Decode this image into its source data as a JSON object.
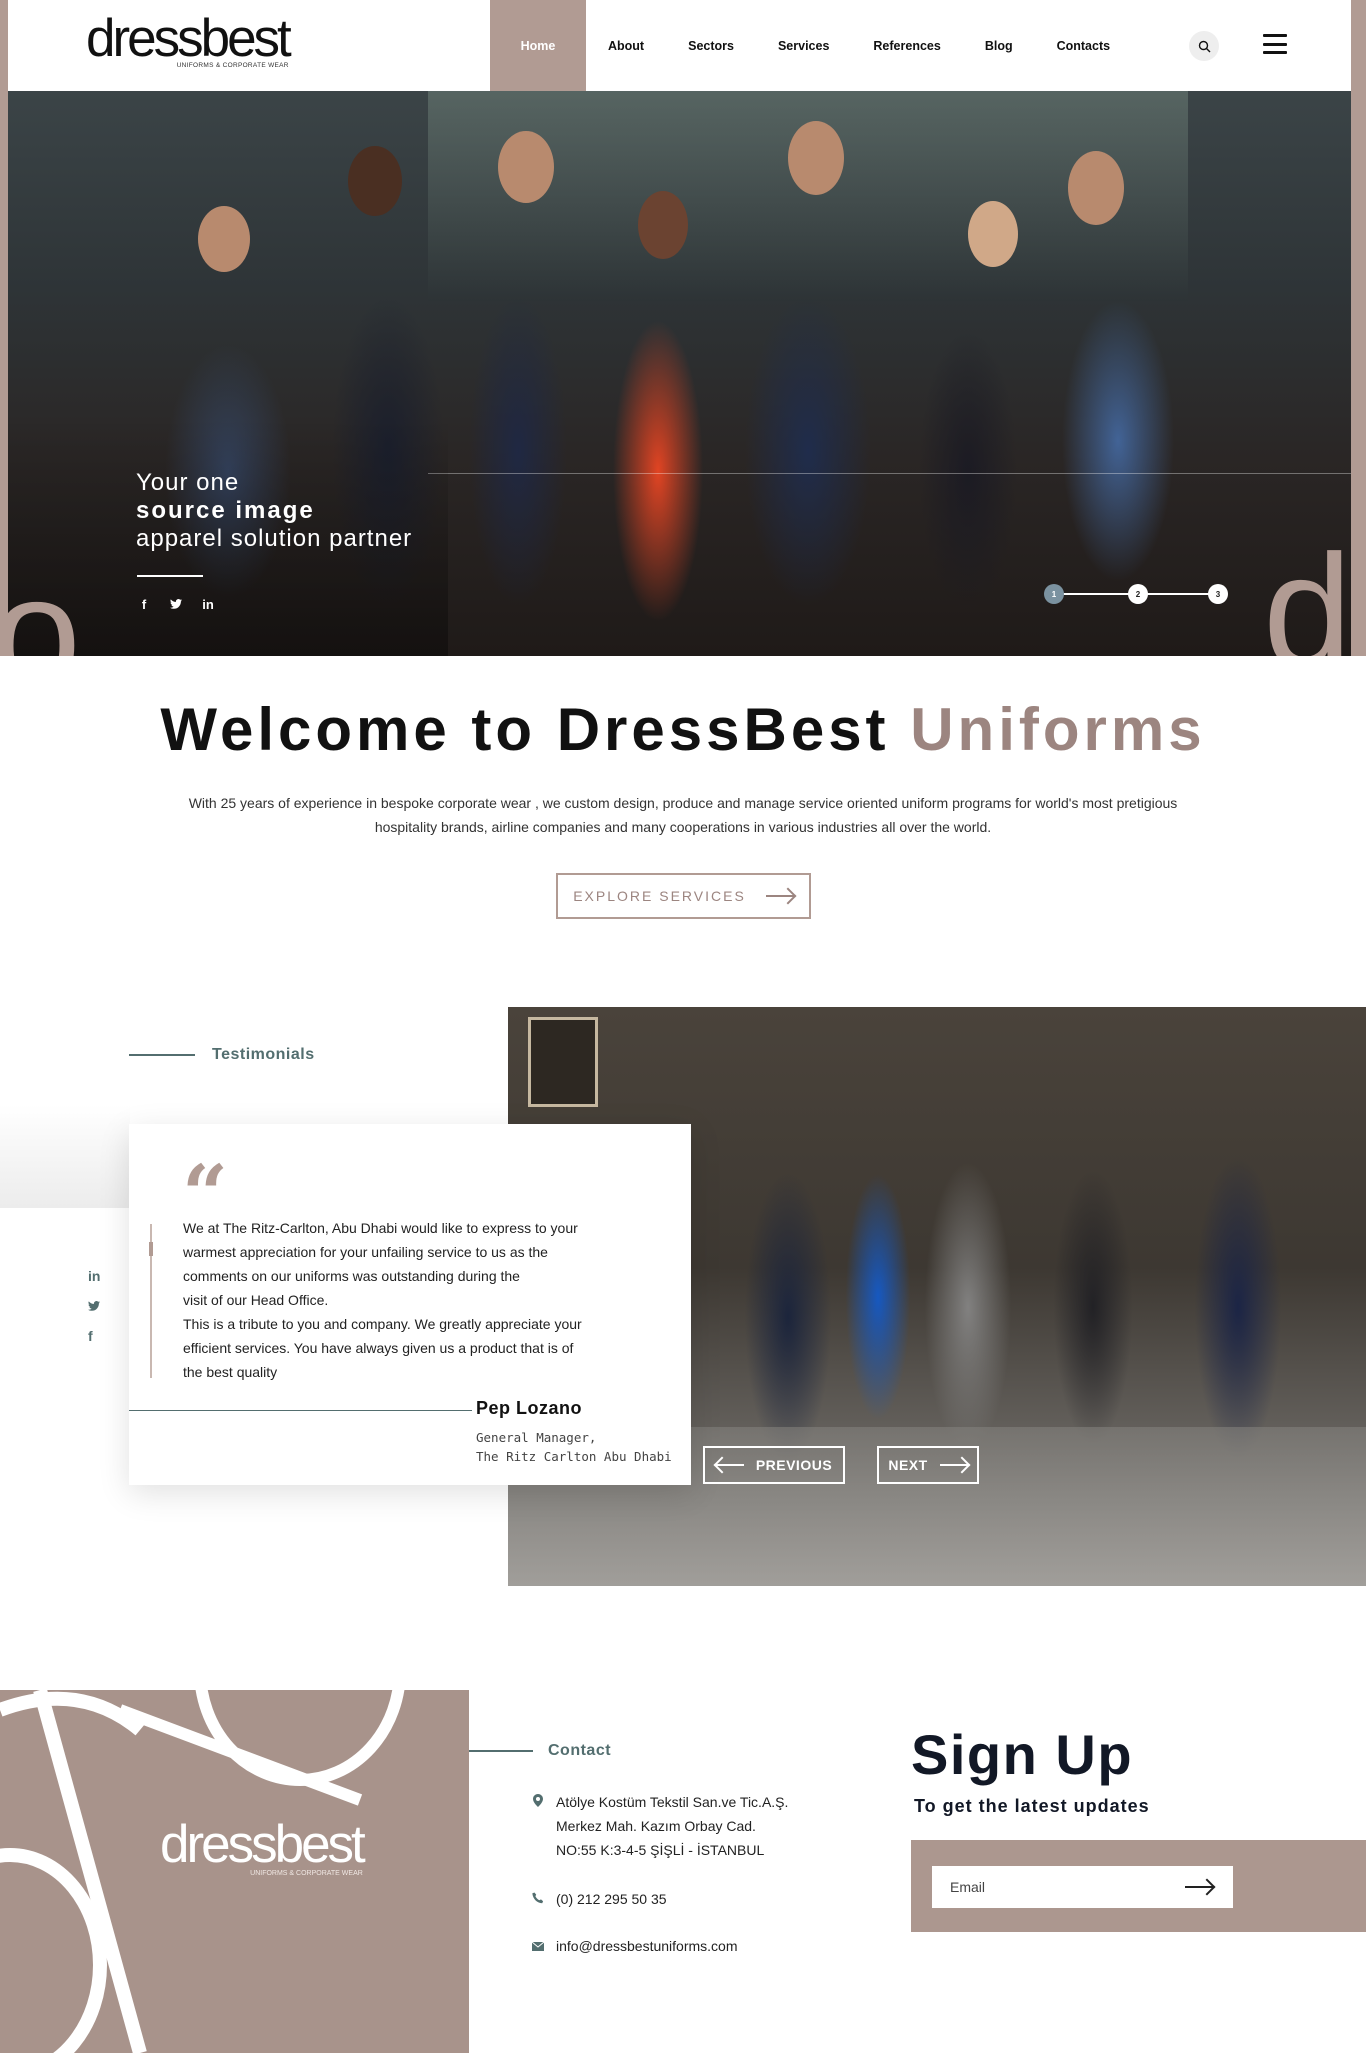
{
  "header": {
    "logo_word_dark": "dress",
    "logo_word_light": "best",
    "logo_tagline": "UNIFORMS & CORPORATE WEAR",
    "nav": [
      {
        "label": "Home",
        "active": true
      },
      {
        "label": "About"
      },
      {
        "label": "Sectors"
      },
      {
        "label": "Services"
      },
      {
        "label": "References"
      },
      {
        "label": "Blog"
      },
      {
        "label": "Contacts"
      }
    ],
    "icons": {
      "search": "search-icon",
      "menu": "hamburger-menu-icon"
    }
  },
  "hero": {
    "line1": "Your one",
    "line2": "source image",
    "line3": "apparel solution partner",
    "social": [
      "f",
      "t",
      "in"
    ],
    "slides": [
      "1",
      "2",
      "3"
    ],
    "active_slide": 1,
    "deco_left": "o",
    "deco_right": "d"
  },
  "welcome": {
    "title_main": "Welcome to DressBest",
    "title_accent": "Uniforms",
    "text": "With 25 years of experience in bespoke corporate wear , we custom design, produce and manage  service oriented uniform programs for world's most pretigious hospitality brands, airline companies  and many cooperations  in various industries all over the world.",
    "button": "EXPLORE SERVICES"
  },
  "testimonials": {
    "label": "Testimonials",
    "quote_mark": "“",
    "quote_lines": [
      "We at The Ritz-Carlton, Abu Dhabi would like to express to your",
      "warmest appreciation for your unfailing service to us as the",
      "comments on our uniforms was outstanding during the",
      "visit of our Head Office.",
      "This is a tribute to you and company. We greatly appreciate your",
      "efficient services. You have always given us a product that is of",
      "the best quality"
    ],
    "author": "Pep Lozano",
    "role_line1": "General Manager,",
    "role_line2": "The Ritz Carlton Abu Dhabi",
    "prev_label": "PREVIOUS",
    "next_label": "NEXT",
    "social": [
      "in",
      "t",
      "f"
    ]
  },
  "footer": {
    "logo_word_dark": "dress",
    "logo_word_light": "best",
    "logo_tagline": "UNIFORMS & CORPORATE WEAR",
    "contact_label": "Contact",
    "address_lines": [
      "Atölye Kostüm Tekstil San.ve Tic.A.Ş.",
      "Merkez Mah. Kazım Orbay Cad.",
      "NO:55 K:3-4-5 ŞİŞLİ - İSTANBUL"
    ],
    "phone": "(0) 212 295 50 35",
    "email": "info@dressbestuniforms.com",
    "signup_title": "Sign Up",
    "signup_sub": "To get the latest updates",
    "email_placeholder": "Email"
  },
  "colors": {
    "accent": "#b19b93",
    "accent_text": "#9c8580",
    "teal": "#536e6f",
    "dark_navy": "#121826"
  }
}
